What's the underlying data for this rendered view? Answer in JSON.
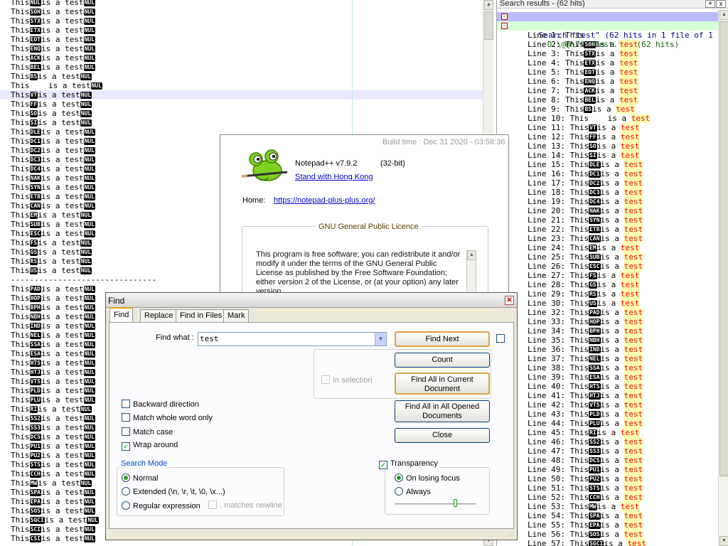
{
  "colors": {
    "accent": "#21a121",
    "highlight": "#ff0000",
    "control_char_bg": "#000000",
    "link": "#0000cc"
  },
  "editor": {
    "lines": [
      {
        "pre": "This",
        "cc": "NUL",
        "mid": "is a test",
        "tail": "NUL"
      },
      {
        "pre": "This",
        "cc": "SOH",
        "mid": "is a test",
        "tail": "NUL"
      },
      {
        "pre": "This",
        "cc": "STX",
        "mid": "is a test",
        "tail": "NUL"
      },
      {
        "pre": "This",
        "cc": "ETX",
        "mid": "is a test",
        "tail": "NUL"
      },
      {
        "pre": "This",
        "cc": "EOT",
        "mid": "is a test",
        "tail": "NUL"
      },
      {
        "pre": "This",
        "cc": "ENQ",
        "mid": "is a test",
        "tail": "NUL"
      },
      {
        "pre": "This",
        "cc": "ACK",
        "mid": "is a test",
        "tail": "NUL"
      },
      {
        "pre": "This",
        "cc": "BEL",
        "mid": "is a test",
        "tail": "NUL"
      },
      {
        "pre": "This",
        "cc": "BS",
        "mid": "is a test",
        "tail": "NUL"
      },
      {
        "pre": "This    is a test",
        "cc": "",
        "mid": "",
        "tail": "NUL"
      },
      {
        "pre": "This",
        "cc": "VT",
        "mid": "is a test",
        "tail": "NUL",
        "current": true
      },
      {
        "pre": "This",
        "cc": "FF",
        "mid": "is a test",
        "tail": "NUL"
      },
      {
        "pre": "This",
        "cc": "SO",
        "mid": "is a test",
        "tail": "NUL"
      },
      {
        "pre": "This",
        "cc": "SI",
        "mid": "is a test",
        "tail": "NUL"
      },
      {
        "pre": "This",
        "cc": "DLE",
        "mid": "is a test",
        "tail": "NUL"
      },
      {
        "pre": "This",
        "cc": "DC1",
        "mid": "is a test",
        "tail": "NUL"
      },
      {
        "pre": "This",
        "cc": "DC2",
        "mid": "is a test",
        "tail": "NUL"
      },
      {
        "pre": "This",
        "cc": "DC3",
        "mid": "is a test",
        "tail": "NUL"
      },
      {
        "pre": "This",
        "cc": "DC4",
        "mid": "is a test",
        "tail": "NUL"
      },
      {
        "pre": "This",
        "cc": "NAK",
        "mid": "is a test",
        "tail": "NUL"
      },
      {
        "pre": "This",
        "cc": "SYN",
        "mid": "is a test",
        "tail": "NUL"
      },
      {
        "pre": "This",
        "cc": "ETB",
        "mid": "is a test",
        "tail": "NUL"
      },
      {
        "pre": "This",
        "cc": "CAN",
        "mid": "is a test",
        "tail": "NUL"
      },
      {
        "pre": "This",
        "cc": "EM",
        "mid": "is a test",
        "tail": "NUL"
      },
      {
        "pre": "This",
        "cc": "SUB",
        "mid": "is a test",
        "tail": "NUL"
      },
      {
        "pre": "This",
        "cc": "ESC",
        "mid": "is a test",
        "tail": "NUL"
      },
      {
        "pre": "This",
        "cc": "FS",
        "mid": "is a test",
        "tail": "NUL"
      },
      {
        "pre": "This",
        "cc": "GS",
        "mid": "is a test",
        "tail": "NUL"
      },
      {
        "pre": "This",
        "cc": "RS",
        "mid": "is a test",
        "tail": "NUL"
      },
      {
        "pre": "This",
        "cc": "US",
        "mid": "is a test",
        "tail": "NUL"
      },
      {
        "pre": "-------------------------------",
        "cc": "",
        "mid": "",
        "tail": ""
      },
      {
        "pre": "This",
        "cc": "PAD",
        "mid": "is a test",
        "tail": "NUL"
      },
      {
        "pre": "This",
        "cc": "HOP",
        "mid": "is a test",
        "tail": "NUL"
      },
      {
        "pre": "This",
        "cc": "BPH",
        "mid": "is a test",
        "tail": "NUL"
      },
      {
        "pre": "This",
        "cc": "NBH",
        "mid": "is a test",
        "tail": "NUL"
      },
      {
        "pre": "This",
        "cc": "IND",
        "mid": "is a test",
        "tail": "NUL"
      },
      {
        "pre": "This",
        "cc": "NEL",
        "mid": "is a test",
        "tail": "NUL"
      },
      {
        "pre": "This",
        "cc": "SSA",
        "mid": "is a test",
        "tail": "NUL"
      },
      {
        "pre": "This",
        "cc": "ESA",
        "mid": "is a test",
        "tail": "NUL"
      },
      {
        "pre": "This",
        "cc": "HTS",
        "mid": "is a test",
        "tail": "NUL"
      },
      {
        "pre": "This",
        "cc": "HTJ",
        "mid": "is a test",
        "tail": "NUL"
      },
      {
        "pre": "This",
        "cc": "VTS",
        "mid": "is a test",
        "tail": "NUL"
      },
      {
        "pre": "This",
        "cc": "PLD",
        "mid": "is a test",
        "tail": "NUL"
      },
      {
        "pre": "This",
        "cc": "PLU",
        "mid": "is a test",
        "tail": "NUL"
      },
      {
        "pre": "This",
        "cc": "RI",
        "mid": "is a test",
        "tail": "NUL"
      },
      {
        "pre": "This",
        "cc": "SS2",
        "mid": "is a test",
        "tail": "NUL"
      },
      {
        "pre": "This",
        "cc": "SS3",
        "mid": "is a test",
        "tail": "NUL"
      },
      {
        "pre": "This",
        "cc": "DCS",
        "mid": "is a test",
        "tail": "NUL"
      },
      {
        "pre": "This",
        "cc": "PU1",
        "mid": "is a test",
        "tail": "NUL"
      },
      {
        "pre": "This",
        "cc": "PU2",
        "mid": "is a test",
        "tail": "NUL"
      },
      {
        "pre": "This",
        "cc": "STS",
        "mid": "is a test",
        "tail": "NUL"
      },
      {
        "pre": "This",
        "cc": "CCH",
        "mid": "is a test",
        "tail": "NUL"
      },
      {
        "pre": "This",
        "cc": "MW",
        "mid": "is a test",
        "tail": "NUL"
      },
      {
        "pre": "This",
        "cc": "SPA",
        "mid": "is a test",
        "tail": "NUL"
      },
      {
        "pre": "This",
        "cc": "EPA",
        "mid": "is a test",
        "tail": "NUL"
      },
      {
        "pre": "This",
        "cc": "SOS",
        "mid": "is a test",
        "tail": "NUL"
      },
      {
        "pre": "This",
        "cc": "SGCI",
        "mid": "is a test",
        "tail": "NUL"
      },
      {
        "pre": "This",
        "cc": "SCI",
        "mid": "is a test",
        "tail": "NUL"
      },
      {
        "pre": "This",
        "cc": "CSI",
        "mid": "is a test",
        "tail": "NUL"
      }
    ]
  },
  "results": {
    "header": "Search results - (62 hits)",
    "add_label": "+",
    "close_label": "x",
    "search_line": "Search \"test\" (62 hits in 1 file of 1 searched)",
    "file_line": "D:\\@@\\792\\Test.txt (62 hits)",
    "fold_minus": "-",
    "hits": [
      {
        "label": "Line 1: This",
        "cc": "",
        "mid": "",
        "hl": ""
      },
      {
        "label": "Line 2: This",
        "cc": "SOH",
        "mid": "is a ",
        "hl": "test"
      },
      {
        "label": "Line 3: This",
        "cc": "STX",
        "mid": "is a ",
        "hl": "test"
      },
      {
        "label": "Line 4: This",
        "cc": "ETX",
        "mid": "is a ",
        "hl": "test"
      },
      {
        "label": "Line 5: This",
        "cc": "EOT",
        "mid": "is a ",
        "hl": "test"
      },
      {
        "label": "Line 6: This",
        "cc": "ENQ",
        "mid": "is a ",
        "hl": "test"
      },
      {
        "label": "Line 7: This",
        "cc": "ACK",
        "mid": "is a ",
        "hl": "test"
      },
      {
        "label": "Line 8: This",
        "cc": "BEL",
        "mid": "is a ",
        "hl": "test"
      },
      {
        "label": "Line 9: This",
        "cc": "BS",
        "mid": "is a ",
        "hl": "test"
      },
      {
        "label": "Line 10: This    is a ",
        "cc": "",
        "mid": "",
        "hl": "test"
      },
      {
        "label": "Line 11: This",
        "cc": "VT",
        "mid": "is a ",
        "hl": "test"
      },
      {
        "label": "Line 12: This",
        "cc": "FF",
        "mid": "is a ",
        "hl": "test"
      },
      {
        "label": "Line 13: This",
        "cc": "SO",
        "mid": "is a ",
        "hl": "test"
      },
      {
        "label": "Line 14: This",
        "cc": "SI",
        "mid": "is a ",
        "hl": "test"
      },
      {
        "label": "Line 15: This",
        "cc": "DLE",
        "mid": "is a ",
        "hl": "test"
      },
      {
        "label": "Line 16: This",
        "cc": "DC1",
        "mid": "is a ",
        "hl": "test"
      },
      {
        "label": "Line 17: This",
        "cc": "DC2",
        "mid": "is a ",
        "hl": "test"
      },
      {
        "label": "Line 18: This",
        "cc": "DC3",
        "mid": "is a ",
        "hl": "test"
      },
      {
        "label": "Line 19: This",
        "cc": "DC4",
        "mid": "is a ",
        "hl": "test"
      },
      {
        "label": "Line 20: This",
        "cc": "NAK",
        "mid": "is a ",
        "hl": "test"
      },
      {
        "label": "Line 21: This",
        "cc": "SYN",
        "mid": "is a ",
        "hl": "test"
      },
      {
        "label": "Line 22: This",
        "cc": "ETB",
        "mid": "is a ",
        "hl": "test"
      },
      {
        "label": "Line 23: This",
        "cc": "CAN",
        "mid": "is a ",
        "hl": "test"
      },
      {
        "label": "Line 24: This",
        "cc": "EM",
        "mid": "is a ",
        "hl": "test"
      },
      {
        "label": "Line 25: This",
        "cc": "SUB",
        "mid": "is a ",
        "hl": "test"
      },
      {
        "label": "Line 26: This",
        "cc": "ESC",
        "mid": "is a ",
        "hl": "test"
      },
      {
        "label": "Line 27: This",
        "cc": "FS",
        "mid": "is a ",
        "hl": "test"
      },
      {
        "label": "Line 28: This",
        "cc": "GS",
        "mid": "is a ",
        "hl": "test"
      },
      {
        "label": "Line 29: This",
        "cc": "RS",
        "mid": "is a ",
        "hl": "test"
      },
      {
        "label": "Line 30: This",
        "cc": "US",
        "mid": "is a ",
        "hl": "test"
      },
      {
        "label": "Line 32: This",
        "cc": "PAD",
        "mid": "is a ",
        "hl": "test"
      },
      {
        "label": "Line 33: This",
        "cc": "HOP",
        "mid": "is a ",
        "hl": "test"
      },
      {
        "label": "Line 34: This",
        "cc": "BPH",
        "mid": "is a ",
        "hl": "test"
      },
      {
        "label": "Line 35: This",
        "cc": "NBH",
        "mid": "is a ",
        "hl": "test"
      },
      {
        "label": "Line 36: This",
        "cc": "IND",
        "mid": "is a ",
        "hl": "test"
      },
      {
        "label": "Line 37: This",
        "cc": "NEL",
        "mid": "is a ",
        "hl": "test"
      },
      {
        "label": "Line 38: This",
        "cc": "SSA",
        "mid": "is a ",
        "hl": "test"
      },
      {
        "label": "Line 39: This",
        "cc": "ESA",
        "mid": "is a ",
        "hl": "test"
      },
      {
        "label": "Line 40: This",
        "cc": "HTS",
        "mid": "is a ",
        "hl": "test"
      },
      {
        "label": "Line 41: This",
        "cc": "HTJ",
        "mid": "is a ",
        "hl": "test"
      },
      {
        "label": "Line 42: This",
        "cc": "VTS",
        "mid": "is a ",
        "hl": "test"
      },
      {
        "label": "Line 43: This",
        "cc": "PLD",
        "mid": "is a ",
        "hl": "test"
      },
      {
        "label": "Line 44: This",
        "cc": "PLU",
        "mid": "is a ",
        "hl": "test"
      },
      {
        "label": "Line 45: This",
        "cc": "RI",
        "mid": "is a ",
        "hl": "test"
      },
      {
        "label": "Line 46: This",
        "cc": "SS2",
        "mid": "is a ",
        "hl": "test"
      },
      {
        "label": "Line 47: This",
        "cc": "SS3",
        "mid": "is a ",
        "hl": "test"
      },
      {
        "label": "Line 48: This",
        "cc": "DCS",
        "mid": "is a ",
        "hl": "test"
      },
      {
        "label": "Line 49: This",
        "cc": "PU1",
        "mid": "is a ",
        "hl": "test"
      },
      {
        "label": "Line 50: This",
        "cc": "PU2",
        "mid": "is a ",
        "hl": "test"
      },
      {
        "label": "Line 51: This",
        "cc": "STS",
        "mid": "is a ",
        "hl": "test"
      },
      {
        "label": "Line 52: This",
        "cc": "CCH",
        "mid": "is a ",
        "hl": "test"
      },
      {
        "label": "Line 53: This",
        "cc": "MW",
        "mid": "is a ",
        "hl": "test"
      },
      {
        "label": "Line 54: This",
        "cc": "SPA",
        "mid": "is a ",
        "hl": "test"
      },
      {
        "label": "Line 55: This",
        "cc": "EPA",
        "mid": "is a ",
        "hl": "test"
      },
      {
        "label": "Line 56: This",
        "cc": "SOS",
        "mid": "is a ",
        "hl": "test"
      },
      {
        "label": "Line 57: This",
        "cc": "SGCI",
        "mid": "is a ",
        "hl": "test"
      }
    ]
  },
  "about": {
    "build_time": "Build time : Dec 31 2020 - 03:58:36",
    "version": "Notepad++ v7.9.2",
    "bits": "(32-bit)",
    "hk_link": "Stand with Hong Kong",
    "home_label": "Home:",
    "home_link": "https://notepad-plus-plus.org/",
    "gpl_title": "GNU General Public Licence",
    "gpl_text": "This program is free software; you can redistribute it and/or modify it under the terms of the GNU General Public License as published by the Free Software Foundation; either version 2 of the License, or (at your option) any later version."
  },
  "find": {
    "title": "Find",
    "close_label": "✕",
    "tabs": [
      {
        "label": "Find",
        "active": true
      },
      {
        "label": "Replace",
        "active": false
      },
      {
        "label": "Find in Files",
        "active": false
      },
      {
        "label": "Mark",
        "active": false
      }
    ],
    "find_what_label": "Find what :",
    "find_what_value": "test",
    "dropdown_arrow": "▼",
    "buttons": {
      "find_next": "Find Next",
      "count": "Count",
      "find_all_current": "Find All in Current Document",
      "find_all_opened": "Find All in All Opened Documents",
      "close": "Close"
    },
    "in_selection_label": "In selection",
    "options": [
      {
        "label": "Backward direction",
        "checked": false
      },
      {
        "label": "Match whole word only",
        "checked": false
      },
      {
        "label": "Match case",
        "checked": false
      },
      {
        "label": "Wrap around",
        "checked": true
      }
    ],
    "search_mode": {
      "title": "Search Mode",
      "options": [
        {
          "label": "Normal",
          "selected": true
        },
        {
          "label": "Extended (\\n, \\r, \\t, \\0, \\x...)",
          "selected": false
        },
        {
          "label": "Regular expression",
          "selected": false
        }
      ],
      "matches_newline_label": ". matches newline"
    },
    "transparency": {
      "label": "Transparency",
      "checked": true,
      "options": [
        {
          "label": "On losing focus",
          "selected": true
        },
        {
          "label": "Always",
          "selected": false
        }
      ],
      "level": 0.75
    },
    "check_mark": "✓",
    "grip": "⋰"
  }
}
